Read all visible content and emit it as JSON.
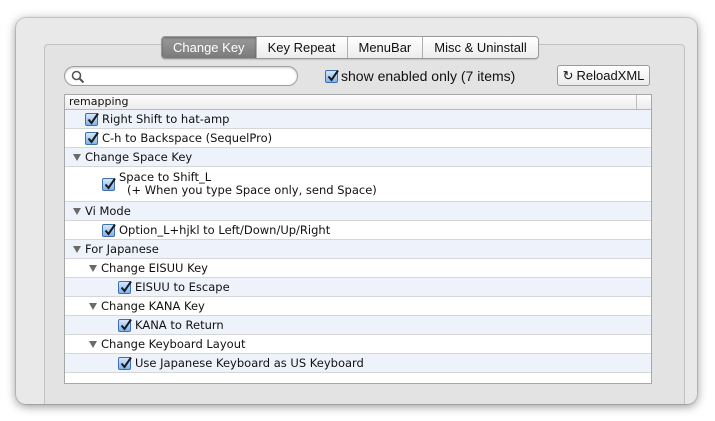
{
  "tabs": [
    {
      "label": "Change Key",
      "active": true
    },
    {
      "label": "Key Repeat",
      "active": false
    },
    {
      "label": "MenuBar",
      "active": false
    },
    {
      "label": "Misc & Uninstall",
      "active": false
    }
  ],
  "search": {
    "value": "",
    "placeholder": ""
  },
  "filter": {
    "label": "show enabled only (7 items)",
    "checked": true
  },
  "reload": {
    "label": "ReloadXML",
    "icon": "reload-icon"
  },
  "list": {
    "column_header": "remapping",
    "rows": [
      {
        "type": "item",
        "label": "Right Shift to hat-amp",
        "checked": true
      },
      {
        "type": "item",
        "label": "C-h to Backspace (SequelPro)",
        "checked": true
      },
      {
        "type": "group",
        "label": "Change Space Key"
      },
      {
        "type": "item",
        "label": "Space to Shift_L",
        "desc": "(+ When you type Space only, send Space)",
        "checked": true
      },
      {
        "type": "group",
        "label": "Vi Mode"
      },
      {
        "type": "item",
        "label": "Option_L+hjkl to Left/Down/Up/Right",
        "checked": true
      },
      {
        "type": "group",
        "label": "For Japanese"
      },
      {
        "type": "group",
        "label": "Change EISUU Key"
      },
      {
        "type": "item",
        "label": "EISUU to Escape",
        "checked": true
      },
      {
        "type": "group",
        "label": "Change KANA Key"
      },
      {
        "type": "item",
        "label": "KANA to Return",
        "checked": true
      },
      {
        "type": "group",
        "label": "Change Keyboard Layout"
      },
      {
        "type": "item",
        "label": "Use Japanese Keyboard as US Keyboard",
        "checked": true
      }
    ]
  },
  "colors": {
    "checkbox_accent": "#3f6fb3",
    "alt_row": "#eef3fb"
  }
}
